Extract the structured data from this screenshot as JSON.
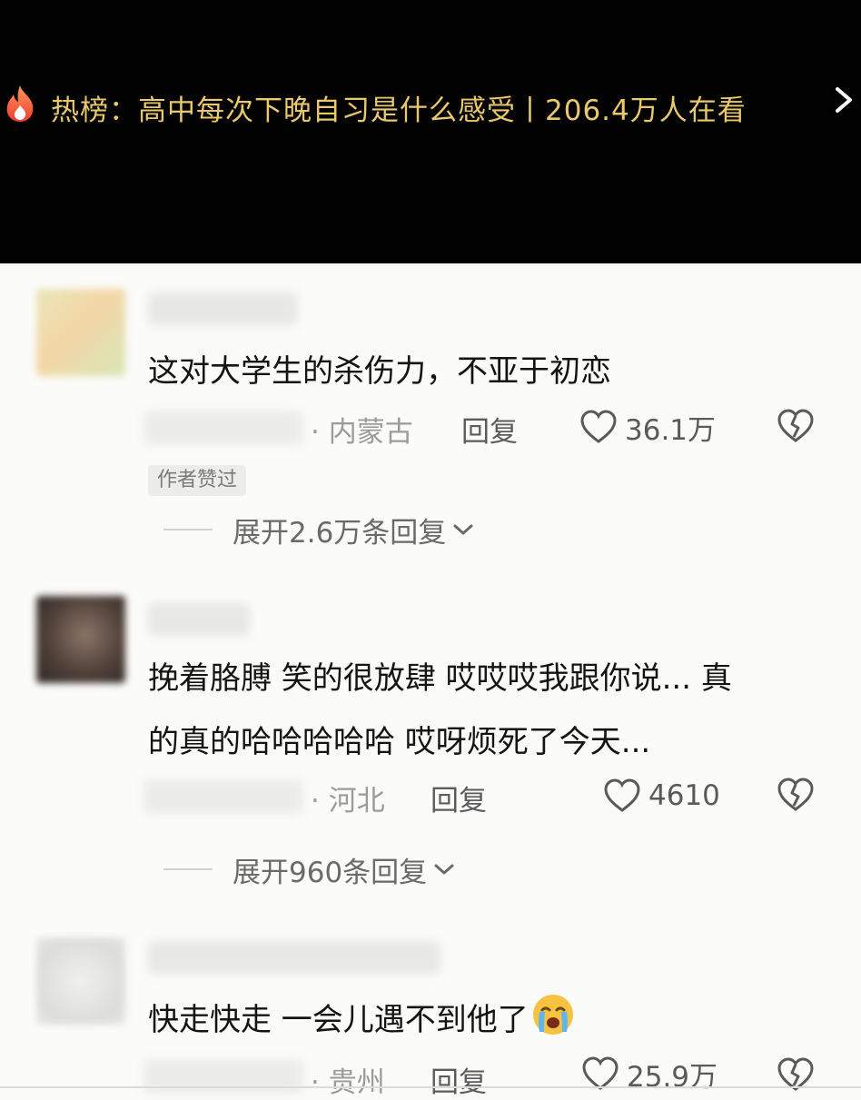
{
  "hot_banner": {
    "icon": "flame-icon",
    "text": "热榜：高中每次下晚自习是什么感受丨206.4万人在看",
    "arrow": "chevron-right-icon",
    "color": "#e9c96b"
  },
  "comments": [
    {
      "text_lines": [
        "这对大学生的杀伤力，不亚于初恋"
      ],
      "location": "· 内蒙古",
      "reply_label": "回复",
      "likes": "36.1万",
      "badge": "作者赞过",
      "expand": "展开2.6万条回复"
    },
    {
      "text_lines": [
        "挽着胳膊 笑的很放肆 哎哎哎我跟你说... 真",
        "的真的哈哈哈哈哈 哎呀烦死了今天..."
      ],
      "location": "· 河北",
      "reply_label": "回复",
      "likes": "4610",
      "expand": "展开960条回复"
    },
    {
      "text_lines": [
        "快走快走 一会儿遇不到他了"
      ],
      "emoji": "crying-emoji",
      "location": "· 贵州",
      "reply_label": "回复",
      "likes": "25.9万"
    }
  ]
}
